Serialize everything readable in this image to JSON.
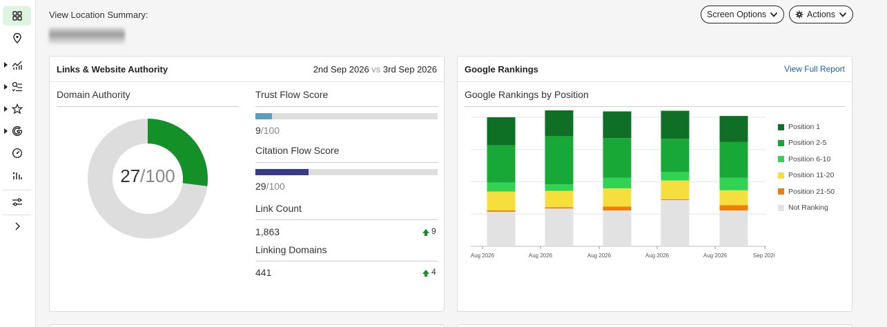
{
  "header": {
    "location_label": "View Location Summary:",
    "screen_options_label": "Screen Options",
    "actions_label": "Actions"
  },
  "sidebar": {
    "items": [
      {
        "icon": "dashboard-icon",
        "active": true
      },
      {
        "icon": "location-pin-icon"
      },
      {
        "icon": "analytics-chart-icon",
        "expandable": true
      },
      {
        "icon": "search-list-icon",
        "expandable": true
      },
      {
        "icon": "star-icon",
        "expandable": true
      },
      {
        "icon": "google-icon",
        "expandable": true
      },
      {
        "icon": "speedometer-icon"
      },
      {
        "icon": "bar-chart-icon"
      },
      {
        "icon": "sliders-icon"
      },
      {
        "icon": "chevron-right-icon"
      }
    ]
  },
  "links_card": {
    "title": "Links & Website Authority",
    "date_from": "2nd Sep 2026",
    "vs": "vs",
    "date_to": "3rd Sep 2026",
    "domain_authority": {
      "heading": "Domain Authority",
      "value": "27",
      "max": "/100",
      "fraction": 0.27
    },
    "trust_flow": {
      "heading": "Trust Flow Score",
      "value": "9",
      "max": "/100",
      "fraction": 0.09,
      "color": "#5b9fbd"
    },
    "citation_flow": {
      "heading": "Citation Flow Score",
      "value": "29",
      "max": "/100",
      "fraction": 0.29,
      "color": "#353b86"
    },
    "link_count": {
      "heading": "Link Count",
      "value": "1,863",
      "delta": "9"
    },
    "linking_domains": {
      "heading": "Linking Domains",
      "value": "441",
      "delta": "4"
    },
    "colors": {
      "donut_fill": "#139128",
      "donut_track": "#dddddd"
    }
  },
  "rankings_card": {
    "title": "Google Rankings",
    "view_report_label": "View Full Report",
    "chart_heading": "Google Rankings by Position"
  },
  "chart_data": {
    "type": "bar",
    "stacked": true,
    "title": "Google Rankings by Position",
    "x_tick_labels": [
      "Aug 2026",
      "Aug 2026",
      "Aug 2026",
      "Aug 2026",
      "Aug 2026",
      "Sep 2026"
    ],
    "series": [
      {
        "name": "Not Ranking",
        "color": "#e2e2e2",
        "values": [
          53,
          58,
          55,
          71,
          55
        ]
      },
      {
        "name": "Position 21-50",
        "color": "#ee7d0b",
        "values": [
          2,
          2,
          6,
          1,
          8
        ]
      },
      {
        "name": "Position 11-20",
        "color": "#f5df3c",
        "values": [
          29,
          25,
          28,
          29,
          23
        ]
      },
      {
        "name": "Position 6-10",
        "color": "#2fd454",
        "values": [
          14,
          10,
          16,
          13,
          19
        ]
      },
      {
        "name": "Position 2-5",
        "color": "#17a838",
        "values": [
          57,
          74,
          61,
          51,
          55
        ]
      },
      {
        "name": "Position 1",
        "color": "#0f6f24",
        "values": [
          43,
          40,
          41,
          43,
          40
        ]
      }
    ],
    "legend_order": [
      "Position 1",
      "Position 2-5",
      "Position 6-10",
      "Position 11-20",
      "Position 21-50",
      "Not Ranking"
    ],
    "ylim": [
      0,
      198
    ],
    "grid": true,
    "legend_position": "right"
  }
}
